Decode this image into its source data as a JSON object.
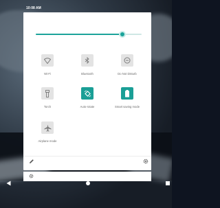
{
  "status_bar": {
    "time": "10:08 AM"
  },
  "brightness": {
    "level": 0.82
  },
  "tiles": [
    {
      "id": "wifi",
      "label": "Wi-Fi",
      "icon": "wifi-icon",
      "active": false
    },
    {
      "id": "bluetooth",
      "label": "Bluetooth",
      "icon": "bluetooth-icon",
      "active": false
    },
    {
      "id": "dnd",
      "label": "Do Not Disturb",
      "icon": "do-not-disturb-icon",
      "active": false
    },
    {
      "id": "torch",
      "label": "Torch",
      "icon": "torch-icon",
      "active": false
    },
    {
      "id": "autorotate",
      "label": "Auto-rotate",
      "icon": "auto-rotate-icon",
      "active": true
    },
    {
      "id": "smartsaving",
      "label": "Smart saving mode",
      "icon": "battery-saver-icon",
      "active": true
    },
    {
      "id": "airplane",
      "label": "Airplane mode",
      "icon": "airplane-icon",
      "active": false
    }
  ],
  "colors": {
    "accent": "#1a9f96",
    "inactive_tile": "#e3e3e3"
  },
  "nav": {
    "back_icon": "back-triangle-icon",
    "home_icon": "home-dot-icon",
    "recents_icon": "recents-square-icon"
  }
}
